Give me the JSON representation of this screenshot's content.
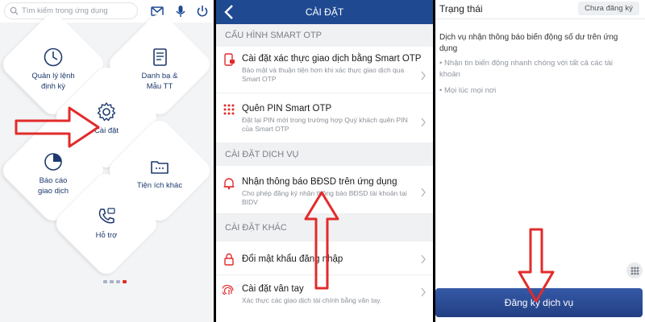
{
  "home": {
    "search_placeholder": "Tìm kiếm trong ứng dụng",
    "tiles": {
      "scheduled_transfer": "Quản lý lệnh định kỳ",
      "contacts": "Danh bạ & Mẫu TT",
      "settings": "Cài đặt",
      "reports": "Báo cáo giao dịch",
      "other_utilities": "Tiện ích khác",
      "support": "Hỗ trợ"
    },
    "page_count": 4,
    "active_page": 4
  },
  "settings": {
    "title": "CÀI ĐẶT",
    "sections": [
      {
        "header": "CẤU HÌNH SMART OTP",
        "items": [
          {
            "title": "Cài đặt xác thực giao dịch bằng Smart OTP",
            "desc": "Bảo mật và thuận tiện hơn khi xác thực giao dịch qua Smart OTP"
          },
          {
            "title": "Quên PIN Smart OTP",
            "desc": "Đặt lại PIN mới trong trường hợp Quý khách quên PIN của Smart OTP"
          }
        ]
      },
      {
        "header": "CÀI ĐẶT DỊCH VỤ",
        "items": [
          {
            "title": "Nhận thông báo BĐSD trên ứng dụng",
            "desc": "Cho phép đăng ký nhận thông báo BĐSD tài khoản tại BIDV"
          }
        ]
      },
      {
        "header": "CÀI ĐẶT KHÁC",
        "items": [
          {
            "title": "Đổi mật khẩu đăng nhập",
            "desc": ""
          },
          {
            "title": "Cài đặt vân tay",
            "desc": "Xác thực các giao dịch tài chính bằng vân tay."
          }
        ]
      }
    ]
  },
  "service": {
    "status_label": "Trạng thái",
    "status_value": "Chưa đăng ký",
    "description": "Dịch vụ nhận thông báo biến động số dư trên ứng dụng",
    "bullets": [
      "Nhận tin biến động nhanh chóng với tất cả các tài khoản",
      "Mọi lúc mọi nơi"
    ],
    "register_label": "Đăng ký dịch vụ"
  },
  "colors": {
    "brand_blue": "#1f4a92",
    "accent_red": "#e22b2b",
    "tile_text": "#1e3a6e"
  },
  "icons": {
    "search": "search-icon",
    "mail": "mail-icon",
    "mic": "microphone-icon",
    "power": "power-icon",
    "clock": "clock-icon",
    "contacts": "notebook-icon",
    "gear": "gear-icon",
    "report": "pie-chart-icon",
    "folder": "folder-icon",
    "phone": "phone-icon",
    "back": "chevron-left-icon",
    "phone_lock": "phone-lock-icon",
    "keypad": "keypad-icon",
    "bell": "bell-icon",
    "padlock": "padlock-icon",
    "fingerprint": "fingerprint-icon",
    "grid": "grid-icon"
  }
}
